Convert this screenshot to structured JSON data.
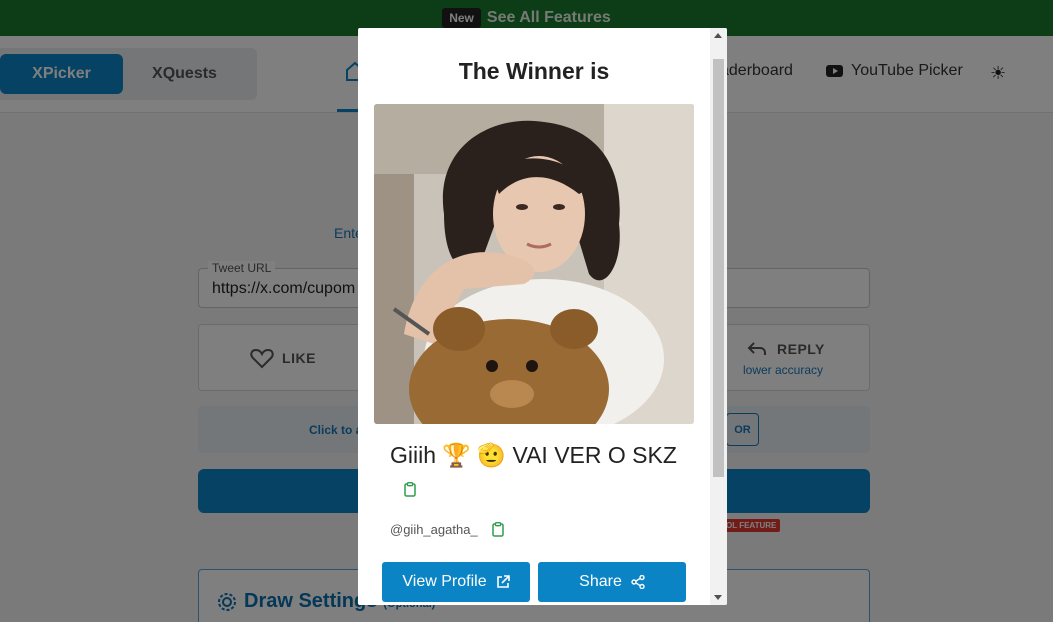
{
  "banner": {
    "badge": "New",
    "link": "See All Features"
  },
  "header": {
    "modes": [
      "XPicker",
      "XQuests"
    ],
    "nav_leaderboard": "aderboard",
    "nav_youtube": "YouTube Picker",
    "icons": {
      "home": "home-icon",
      "youtube": "youtube-icon",
      "theme": "sun-icon"
    }
  },
  "main": {
    "description_left": "Ente",
    "description_right": ".",
    "tweet_url": {
      "label": "Tweet URL",
      "value": "https://x.com/cupom"
    },
    "like_label": "LIKE",
    "reply_label": "REPLY",
    "reply_sub": "lower accuracy",
    "hint_text": "Click to a",
    "or_label": "OR",
    "pro_tag": "OL FEATURE",
    "settings_title": "Draw Settings",
    "settings_optional": "(Optional)"
  },
  "modal": {
    "title": "The Winner is",
    "winner_name": "Giiih 🏆 🫡 VAI VER O SKZ",
    "winner_handle": "@giih_agatha_",
    "view_profile": "View Profile",
    "share": "Share"
  },
  "colors": {
    "accent": "#0b84c6",
    "banner": "#1b7a2c",
    "clipboard": "#2e9e4a"
  }
}
